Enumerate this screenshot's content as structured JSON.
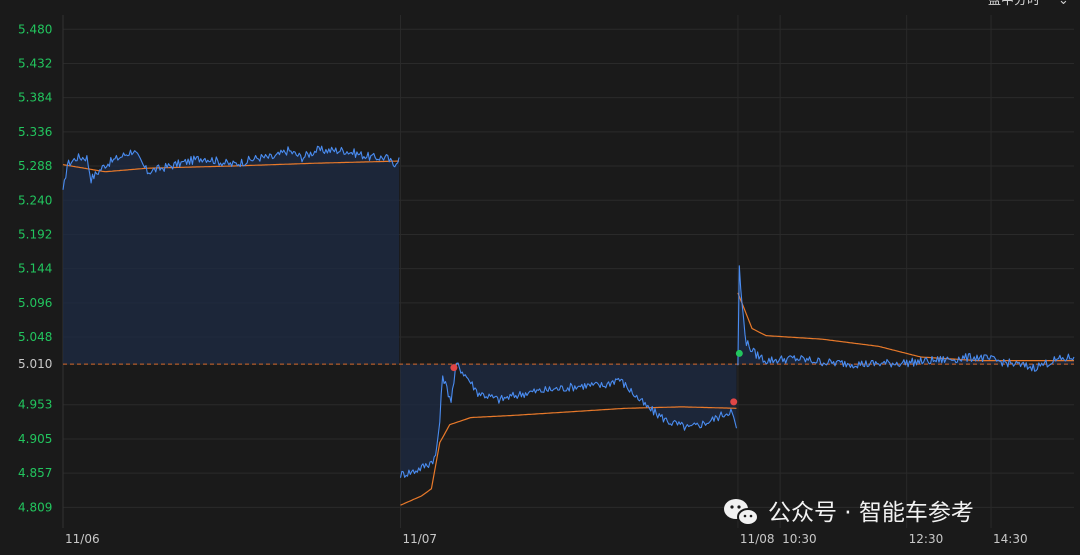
{
  "chart_data": {
    "type": "line",
    "title": "",
    "mode_selector": "盘中分时",
    "ylim": [
      4.78,
      5.5
    ],
    "y_ticks": [
      "5.480",
      "5.432",
      "5.384",
      "5.336",
      "5.288",
      "5.240",
      "5.192",
      "5.144",
      "5.096",
      "5.048",
      "5.010",
      "4.953",
      "4.905",
      "4.857",
      "4.809"
    ],
    "x_ticks": [
      "11/06",
      "11/07",
      "11/08",
      "10:30",
      "12:30",
      "14:30"
    ],
    "x_tick_index": [
      0,
      240,
      480,
      510,
      600,
      660
    ],
    "total_points": 720,
    "days": [
      "11/06",
      "11/07",
      "11/08"
    ],
    "reference_price": 5.01,
    "grid": true,
    "colors": {
      "background": "#1a1a1a",
      "grid": "#2a2a2a",
      "price_line": "#4a8cf0",
      "avg_line": "#e8792a",
      "ref_line": "#d66a2c",
      "up_text": "#22c55e",
      "area_fill": "#1d2b44"
    },
    "series": [
      {
        "key": "price",
        "day_segments": [
          {
            "day": "11/06",
            "start": 0,
            "points": [
              [
                0,
                5.25
              ],
              [
                3,
                5.29
              ],
              [
                10,
                5.3
              ],
              [
                17,
                5.3
              ],
              [
                20,
                5.27
              ],
              [
                30,
                5.29
              ],
              [
                40,
                5.3
              ],
              [
                50,
                5.31
              ],
              [
                60,
                5.28
              ],
              [
                80,
                5.29
              ],
              [
                100,
                5.3
              ],
              [
                120,
                5.29
              ],
              [
                140,
                5.3
              ],
              [
                150,
                5.3
              ],
              [
                160,
                5.31
              ],
              [
                170,
                5.3
              ],
              [
                180,
                5.31
              ],
              [
                200,
                5.31
              ],
              [
                220,
                5.3
              ],
              [
                230,
                5.3
              ],
              [
                235,
                5.29
              ],
              [
                239,
                5.3
              ]
            ]
          },
          {
            "day": "11/07",
            "start": 240,
            "points": [
              [
                240,
                4.855
              ],
              [
                250,
                4.86
              ],
              [
                260,
                4.87
              ],
              [
                265,
                4.88
              ],
              [
                268,
                4.93
              ],
              [
                270,
                4.995
              ],
              [
                273,
                4.975
              ],
              [
                276,
                4.96
              ],
              [
                280,
                5.01
              ],
              [
                288,
                4.99
              ],
              [
                295,
                4.97
              ],
              [
                310,
                4.96
              ],
              [
                330,
                4.97
              ],
              [
                350,
                4.975
              ],
              [
                370,
                4.98
              ],
              [
                385,
                4.98
              ],
              [
                395,
                4.99
              ],
              [
                405,
                4.97
              ],
              [
                415,
                4.95
              ],
              [
                430,
                4.93
              ],
              [
                445,
                4.92
              ],
              [
                460,
                4.93
              ],
              [
                470,
                4.94
              ],
              [
                475,
                4.945
              ],
              [
                479,
                4.92
              ]
            ]
          },
          {
            "day": "11/08",
            "start": 480,
            "points": [
              [
                480,
                5.01
              ],
              [
                481,
                5.145
              ],
              [
                483,
                5.09
              ],
              [
                486,
                5.04
              ],
              [
                492,
                5.025
              ],
              [
                500,
                5.015
              ],
              [
                520,
                5.018
              ],
              [
                545,
                5.012
              ],
              [
                570,
                5.01
              ],
              [
                600,
                5.012
              ],
              [
                625,
                5.016
              ],
              [
                650,
                5.02
              ],
              [
                690,
                5.005
              ],
              [
                705,
                5.015
              ],
              [
                719,
                5.02
              ]
            ]
          }
        ]
      },
      {
        "key": "average",
        "day_segments": [
          {
            "day": "11/06",
            "start": 0,
            "points": [
              [
                0,
                5.29
              ],
              [
                30,
                5.28
              ],
              [
                60,
                5.285
              ],
              [
                120,
                5.288
              ],
              [
                180,
                5.292
              ],
              [
                239,
                5.295
              ]
            ]
          },
          {
            "day": "11/07",
            "start": 240,
            "points": [
              [
                240,
                4.812
              ],
              [
                255,
                4.825
              ],
              [
                262,
                4.835
              ],
              [
                268,
                4.9
              ],
              [
                275,
                4.925
              ],
              [
                290,
                4.935
              ],
              [
                320,
                4.938
              ],
              [
                360,
                4.943
              ],
              [
                400,
                4.948
              ],
              [
                440,
                4.95
              ],
              [
                479,
                4.948
              ]
            ]
          },
          {
            "day": "11/08",
            "start": 480,
            "points": [
              [
                480,
                5.11
              ],
              [
                490,
                5.06
              ],
              [
                500,
                5.05
              ],
              [
                540,
                5.045
              ],
              [
                580,
                5.035
              ],
              [
                610,
                5.02
              ],
              [
                650,
                5.015
              ],
              [
                690,
                5.015
              ],
              [
                719,
                5.015
              ]
            ]
          }
        ]
      }
    ],
    "markers": [
      {
        "index": 278,
        "value": 4.998,
        "color": "#e04646"
      },
      {
        "index": 477,
        "value": 4.95,
        "color": "#e04646"
      },
      {
        "index": 481,
        "value": 5.018,
        "color": "#22c55e"
      }
    ]
  },
  "watermark": {
    "text": "公众号 · 智能车参考",
    "icon": "wechat-icon"
  }
}
